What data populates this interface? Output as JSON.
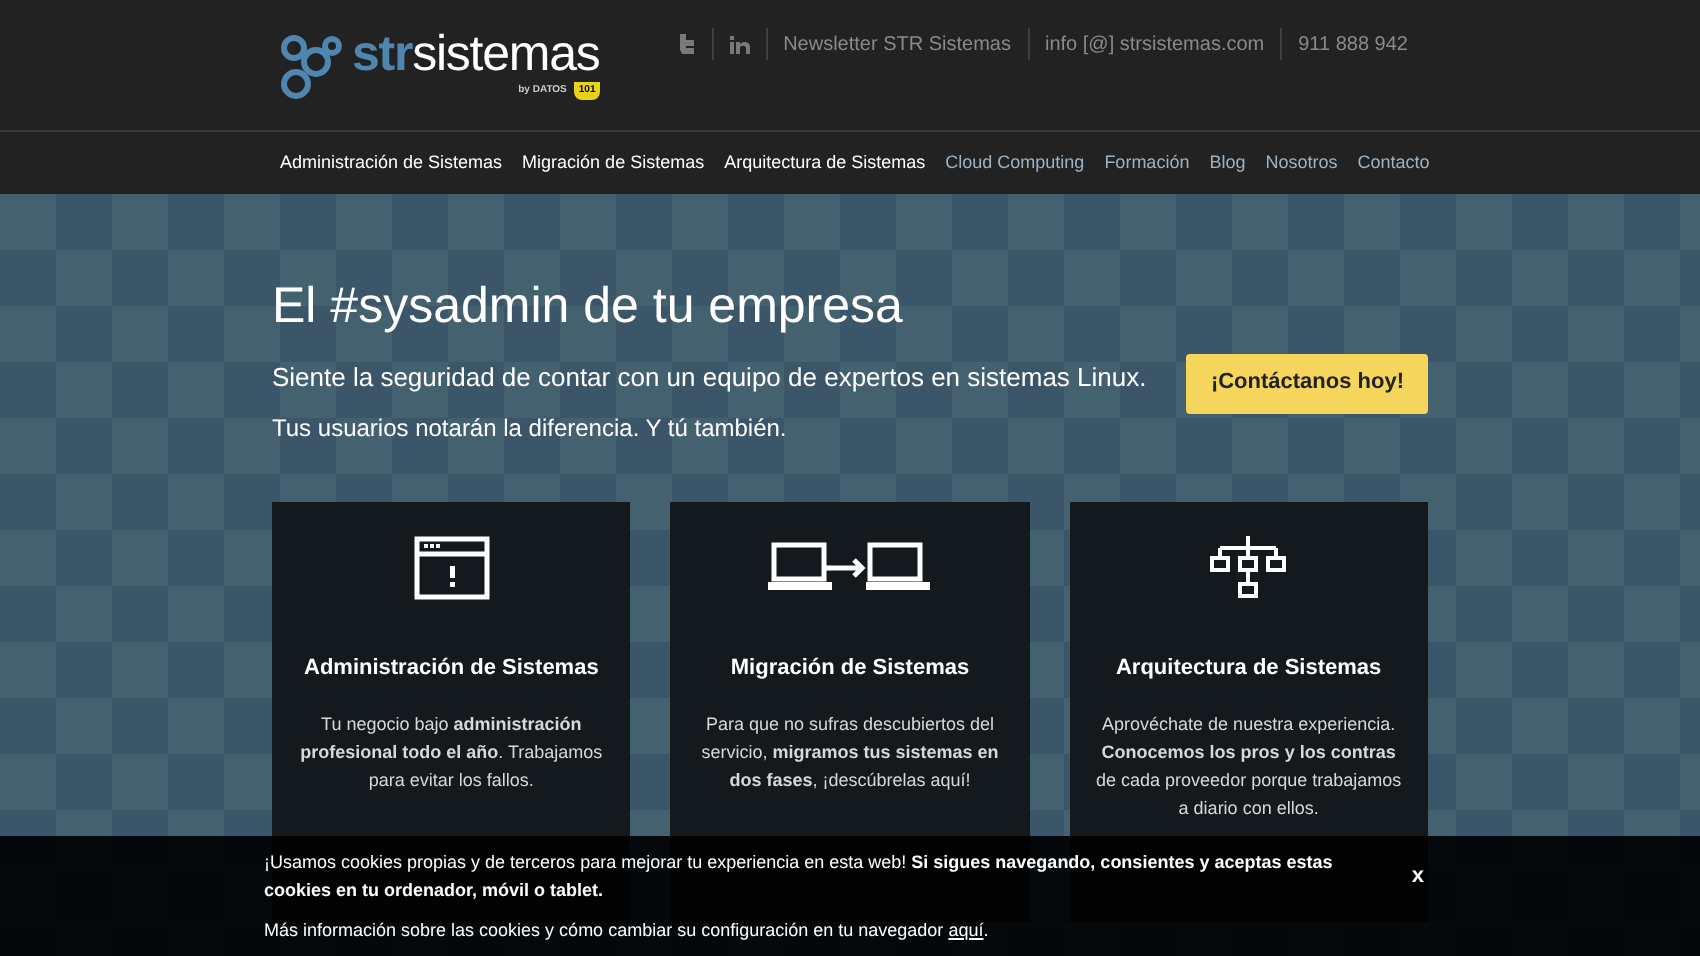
{
  "header": {
    "logo": {
      "brand_bold": "str",
      "brand": "sistemas",
      "byline": "by DATOS",
      "badge": "101"
    },
    "links": [
      {
        "kind": "icon"
      },
      {
        "kind": "icon"
      },
      {
        "kind": "text",
        "label": "Newsletter STR Sistemas"
      },
      {
        "kind": "text",
        "label": "info [@] strsistemas.com"
      },
      {
        "kind": "text",
        "label": "911 888 942"
      }
    ]
  },
  "nav": [
    {
      "label": "Administración de Sistemas",
      "highlighted": true
    },
    {
      "label": "Migración de Sistemas",
      "highlighted": true
    },
    {
      "label": "Arquitectura de Sistemas",
      "highlighted": true
    },
    {
      "label": "Cloud Computing",
      "highlighted": false
    },
    {
      "label": "Formación",
      "highlighted": false
    },
    {
      "label": "Blog",
      "highlighted": false
    },
    {
      "label": "Nosotros",
      "highlighted": false
    },
    {
      "label": "Contacto",
      "highlighted": false
    }
  ],
  "hero": {
    "title": "El #sysadmin de tu empresa",
    "subtitle": "Siente la seguridad de contar con un equipo de expertos en sistemas Linux.",
    "tagline": "Tus usuarios notarán la diferencia. Y tú también.",
    "button": "¡Contáctanos hoy!"
  },
  "cards": [
    {
      "title": "Administración de Sistemas",
      "text": "Tu negocio bajo **administración profesional todo el año**. Trabajamos para evitar los fallos."
    },
    {
      "title": "Migración de Sistemas",
      "text": "Para que no sufras descubiertos del servicio, **migramos tus sistemas en dos fases**, ¡descúbrelas aquí!"
    },
    {
      "title": "Arquitectura de Sistemas",
      "text": "Aprovéchate de nuestra experiencia. **Conocemos los pros y los contras** de cada proveedor porque trabajamos a diario con ellos."
    }
  ],
  "cookie_banner": {
    "message": "¡Usamos cookies propias y de terceros para mejorar tu experiencia en esta web! **Si sigues navegando, consientes y aceptas estas cookies en tu ordenador, móvil o tablet.**",
    "close": "x",
    "info": "Más información sobre las cookies y cómo cambiar su configuración en tu navegador",
    "link": "aquí",
    "end": "."
  }
}
